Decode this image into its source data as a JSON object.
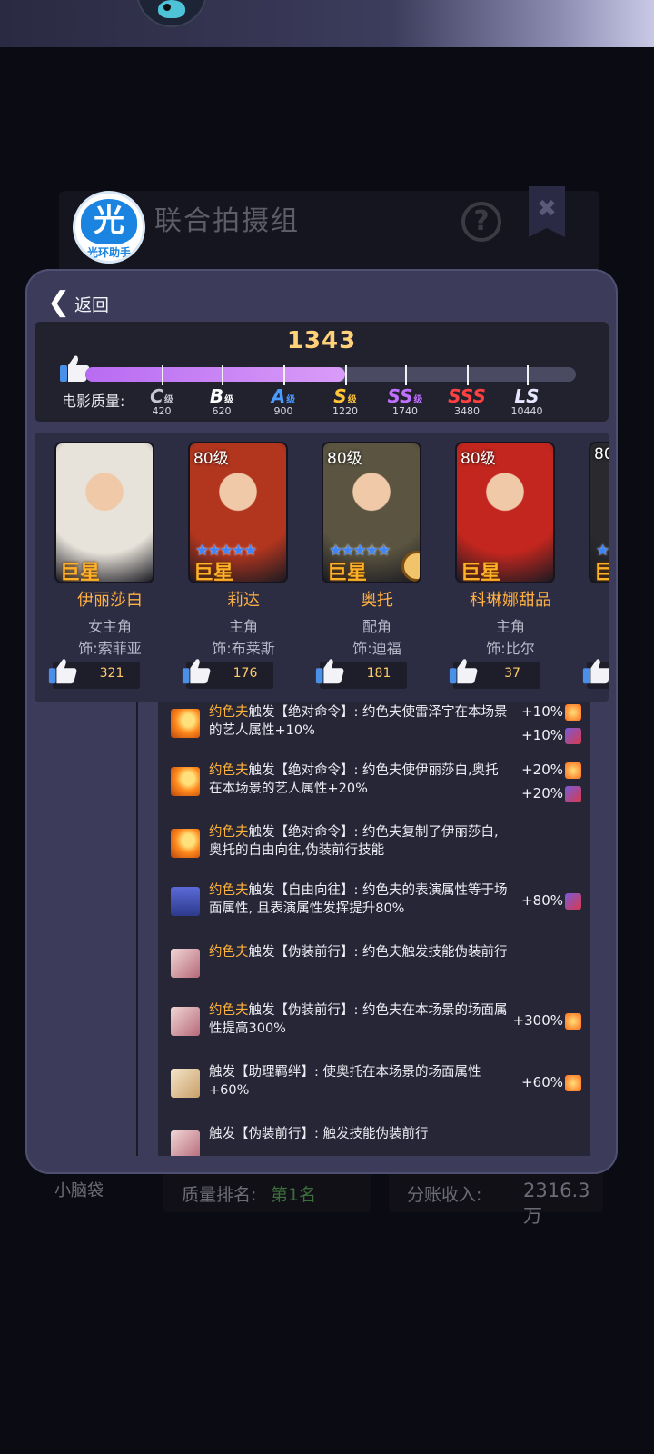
{
  "background": {
    "window_title": "联合拍摄组",
    "help_label": "?",
    "close_label": "✖",
    "badge_main": "光",
    "badge_sub": "光环助手",
    "left_caption": "小脑袋",
    "rank_label": "质量排名:",
    "rank_value": "第1名",
    "income_label": "分账收入:",
    "income_value": "2316.3万"
  },
  "modal": {
    "back_label": "返回",
    "quality": {
      "score": "1343",
      "progress": 0.53,
      "label": "电影质量:",
      "grades": [
        {
          "grade": "C",
          "suffix": "级",
          "threshold": "420",
          "color": "#c8c8d2"
        },
        {
          "grade": "B",
          "suffix": "级",
          "threshold": "620",
          "color": "#ffffff"
        },
        {
          "grade": "A",
          "suffix": "级",
          "threshold": "900",
          "color": "#4a9bff"
        },
        {
          "grade": "S",
          "suffix": "级",
          "threshold": "1220",
          "color": "#ffc437"
        },
        {
          "grade": "SS",
          "suffix": "级",
          "threshold": "1740",
          "color": "#c070ff"
        },
        {
          "grade": "SSS",
          "suffix": "",
          "threshold": "3480",
          "color": "#ff4040"
        },
        {
          "grade": "LS",
          "suffix": "",
          "threshold": "10440",
          "color": "#e6e6ff"
        }
      ]
    },
    "cast": [
      {
        "level": "",
        "stars": "",
        "rank": "巨星",
        "name": "伊丽莎白",
        "role": "女主角",
        "actor": "饰:索菲亚",
        "likes": "321",
        "portrait_color": "#e8e3da",
        "has_badge": false
      },
      {
        "level": "80级",
        "stars": "★★★★★",
        "rank": "巨星",
        "name": "莉达",
        "role": "主角",
        "actor": "饰:布莱斯",
        "likes": "176",
        "portrait_color": "#b2351e",
        "has_badge": false
      },
      {
        "level": "80级",
        "stars": "★★★★★",
        "rank": "巨星",
        "name": "奥托",
        "role": "配角",
        "actor": "饰:迪福",
        "likes": "181",
        "portrait_color": "#5a5440",
        "has_badge": true
      },
      {
        "level": "80级",
        "stars": "",
        "rank": "巨星",
        "name": "科琳娜甜品",
        "role": "主角",
        "actor": "饰:比尔",
        "likes": "37",
        "portrait_color": "#c2261e",
        "has_badge": false
      },
      {
        "level": "80",
        "stars": "★",
        "rank": "巨",
        "name": "",
        "role": "",
        "actor": "饰",
        "likes": "",
        "portrait_color": "#2a2a2e",
        "has_badge": false
      }
    ],
    "log": [
      {
        "icon": "fire",
        "hl": "约色夫",
        "text": "触发【绝对命令】: 约色夫使雷泽宇在本场景的艺人属性+10%",
        "bonuses": [
          "+10%",
          "+10%"
        ]
      },
      {
        "icon": "fire",
        "hl": "约色夫",
        "text": "触发【绝对命令】: 约色夫使伊丽莎白,奥托在本场景的艺人属性+20%",
        "bonuses": [
          "+20%",
          "+20%"
        ]
      },
      {
        "icon": "fire",
        "hl": "约色夫",
        "text": "触发【绝对命令】: 约色夫复制了伊丽莎白,奥托的自由向往,伪装前行技能",
        "bonuses": []
      },
      {
        "icon": "crown",
        "hl": "约色夫",
        "text": "触发【自由向往】: 约色夫的表演属性等于场面属性, 且表演属性发挥提升80%",
        "bonuses": [
          "+80%"
        ]
      },
      {
        "icon": "stairs",
        "hl": "约色夫",
        "text": "触发【伪装前行】: 约色夫触发技能伪装前行",
        "bonuses": []
      },
      {
        "icon": "stairs",
        "hl": "约色夫",
        "text": "触发【伪装前行】: 约色夫在本场景的场面属性提高300%",
        "bonuses": [
          "+300%"
        ]
      },
      {
        "icon": "handshake",
        "hl": "",
        "text": "触发【助理羁绊】: 使奥托在本场景的场面属性+60%",
        "bonuses": [
          "+60%"
        ]
      },
      {
        "icon": "stairs",
        "hl": "",
        "text": "触发【伪装前行】: 触发技能伪装前行",
        "bonuses": []
      }
    ]
  }
}
